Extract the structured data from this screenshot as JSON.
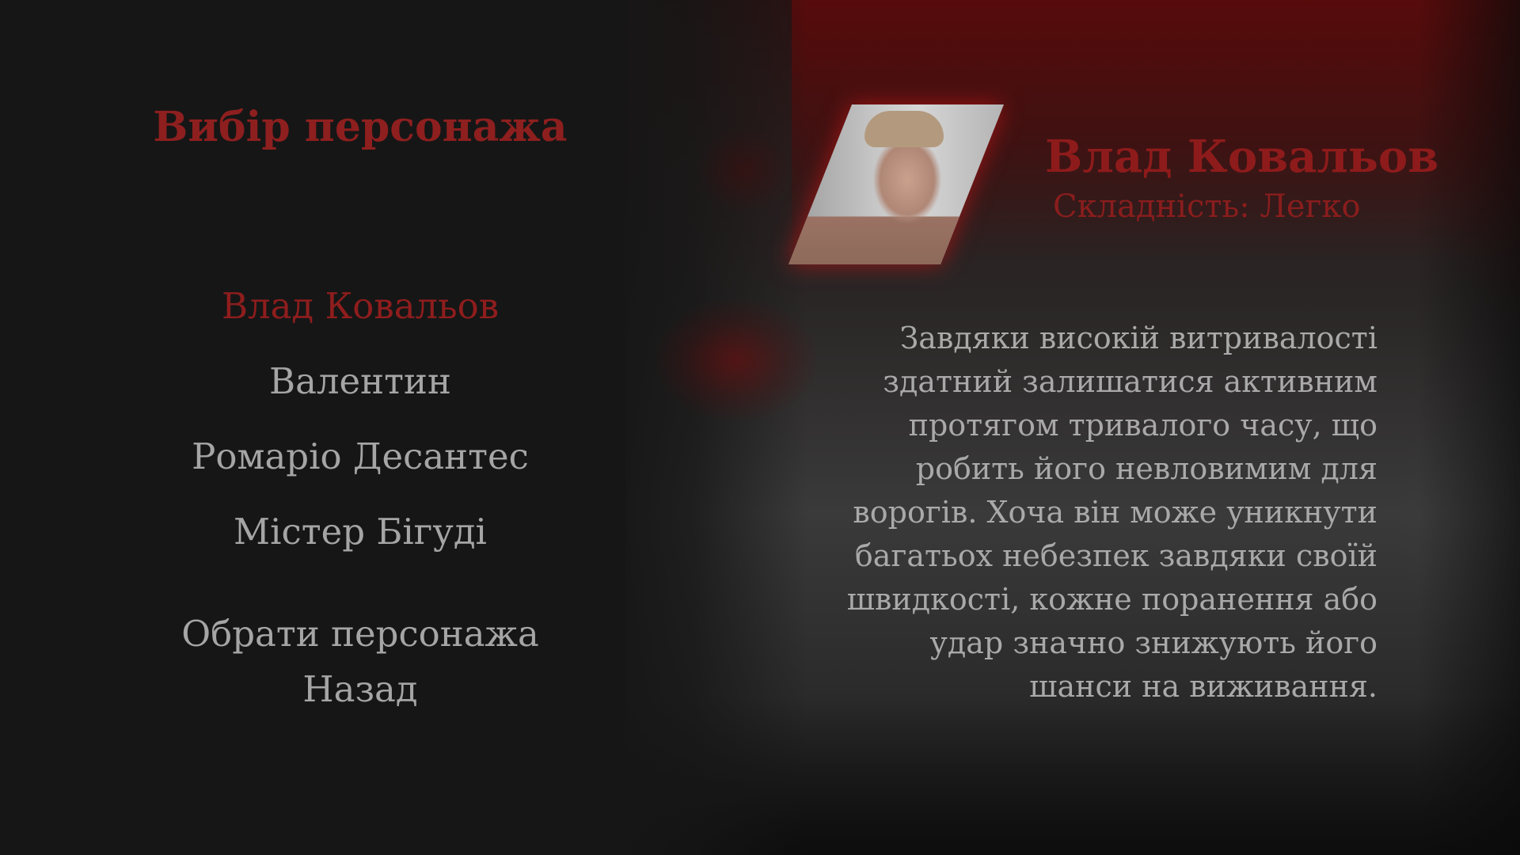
{
  "menu": {
    "title": "Вибір персонажа",
    "characters": [
      {
        "label": "Влад Ковальов",
        "selected": true
      },
      {
        "label": "Валентин",
        "selected": false
      },
      {
        "label": "Ромаріо Десантес",
        "selected": false
      },
      {
        "label": "Містер Бігуді",
        "selected": false
      }
    ],
    "select_label": "Обрати персонажа",
    "back_label": "Назад"
  },
  "character": {
    "name": "Влад Ковальов",
    "difficulty": "Складність: Легко",
    "description_lines": [
      "Завдяки високій витривалості",
      "здатний залишатися активним",
      "протягом тривалого часу, що",
      "робить його невловимим для",
      "ворогів. Хоча він може уникнути",
      "багатьох небезпек завдяки своїй",
      "швидкості, кожне поранення або",
      "удар значно знижують його",
      "шанси на виживання."
    ]
  },
  "colors": {
    "accent_red": "#8e1b1b",
    "menu_text": "#a5a5a5",
    "background": "#161616"
  }
}
